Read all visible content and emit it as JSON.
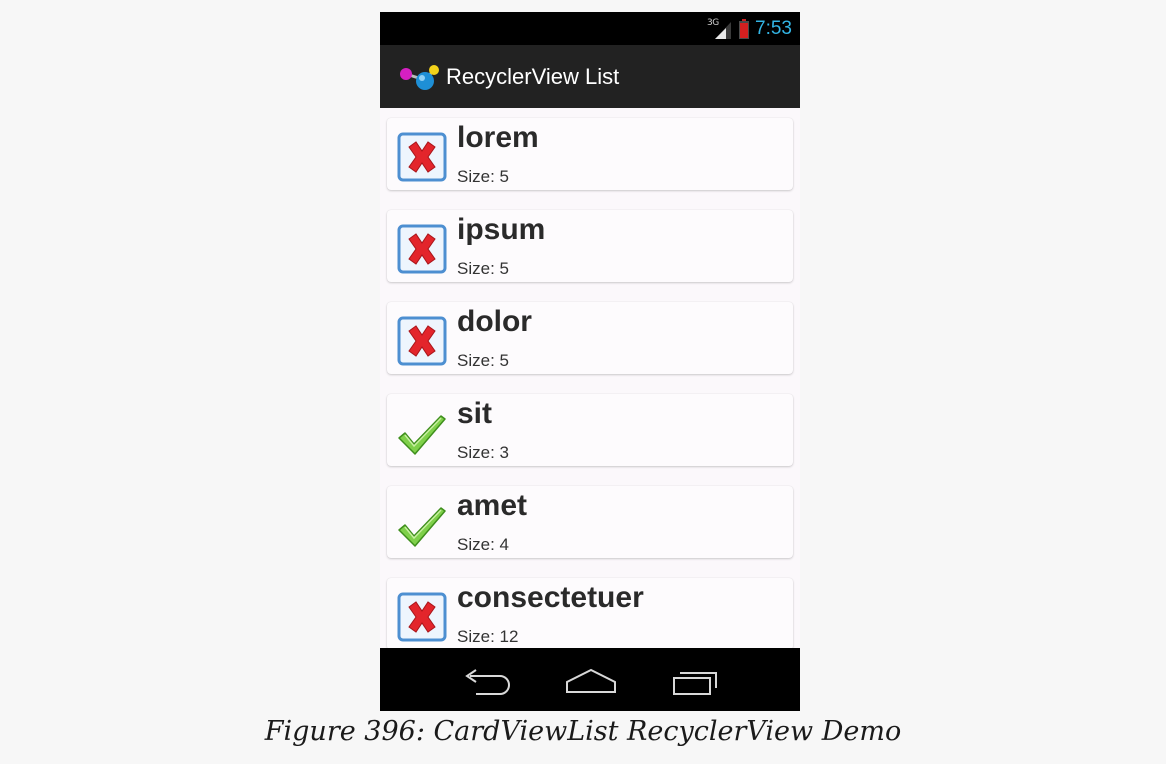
{
  "status_bar": {
    "network": "3G",
    "time": "7:53",
    "time_color": "#33b5e5"
  },
  "action_bar": {
    "title": "RecyclerView List",
    "icon": "app-logo-icon"
  },
  "items": [
    {
      "word": "lorem",
      "size": "Size: 5",
      "icon": "x-mark-icon"
    },
    {
      "word": "ipsum",
      "size": "Size: 5",
      "icon": "x-mark-icon"
    },
    {
      "word": "dolor",
      "size": "Size: 5",
      "icon": "x-mark-icon"
    },
    {
      "word": "sit",
      "size": "Size: 3",
      "icon": "checkmark-icon"
    },
    {
      "word": "amet",
      "size": "Size: 4",
      "icon": "checkmark-icon"
    },
    {
      "word": "consectetuer",
      "size": "Size: 12",
      "icon": "x-mark-icon"
    }
  ],
  "nav_bar": {
    "buttons": [
      "back-icon",
      "home-icon",
      "recent-apps-icon"
    ]
  },
  "caption": "Figure 396: CardViewList RecyclerView Demo"
}
